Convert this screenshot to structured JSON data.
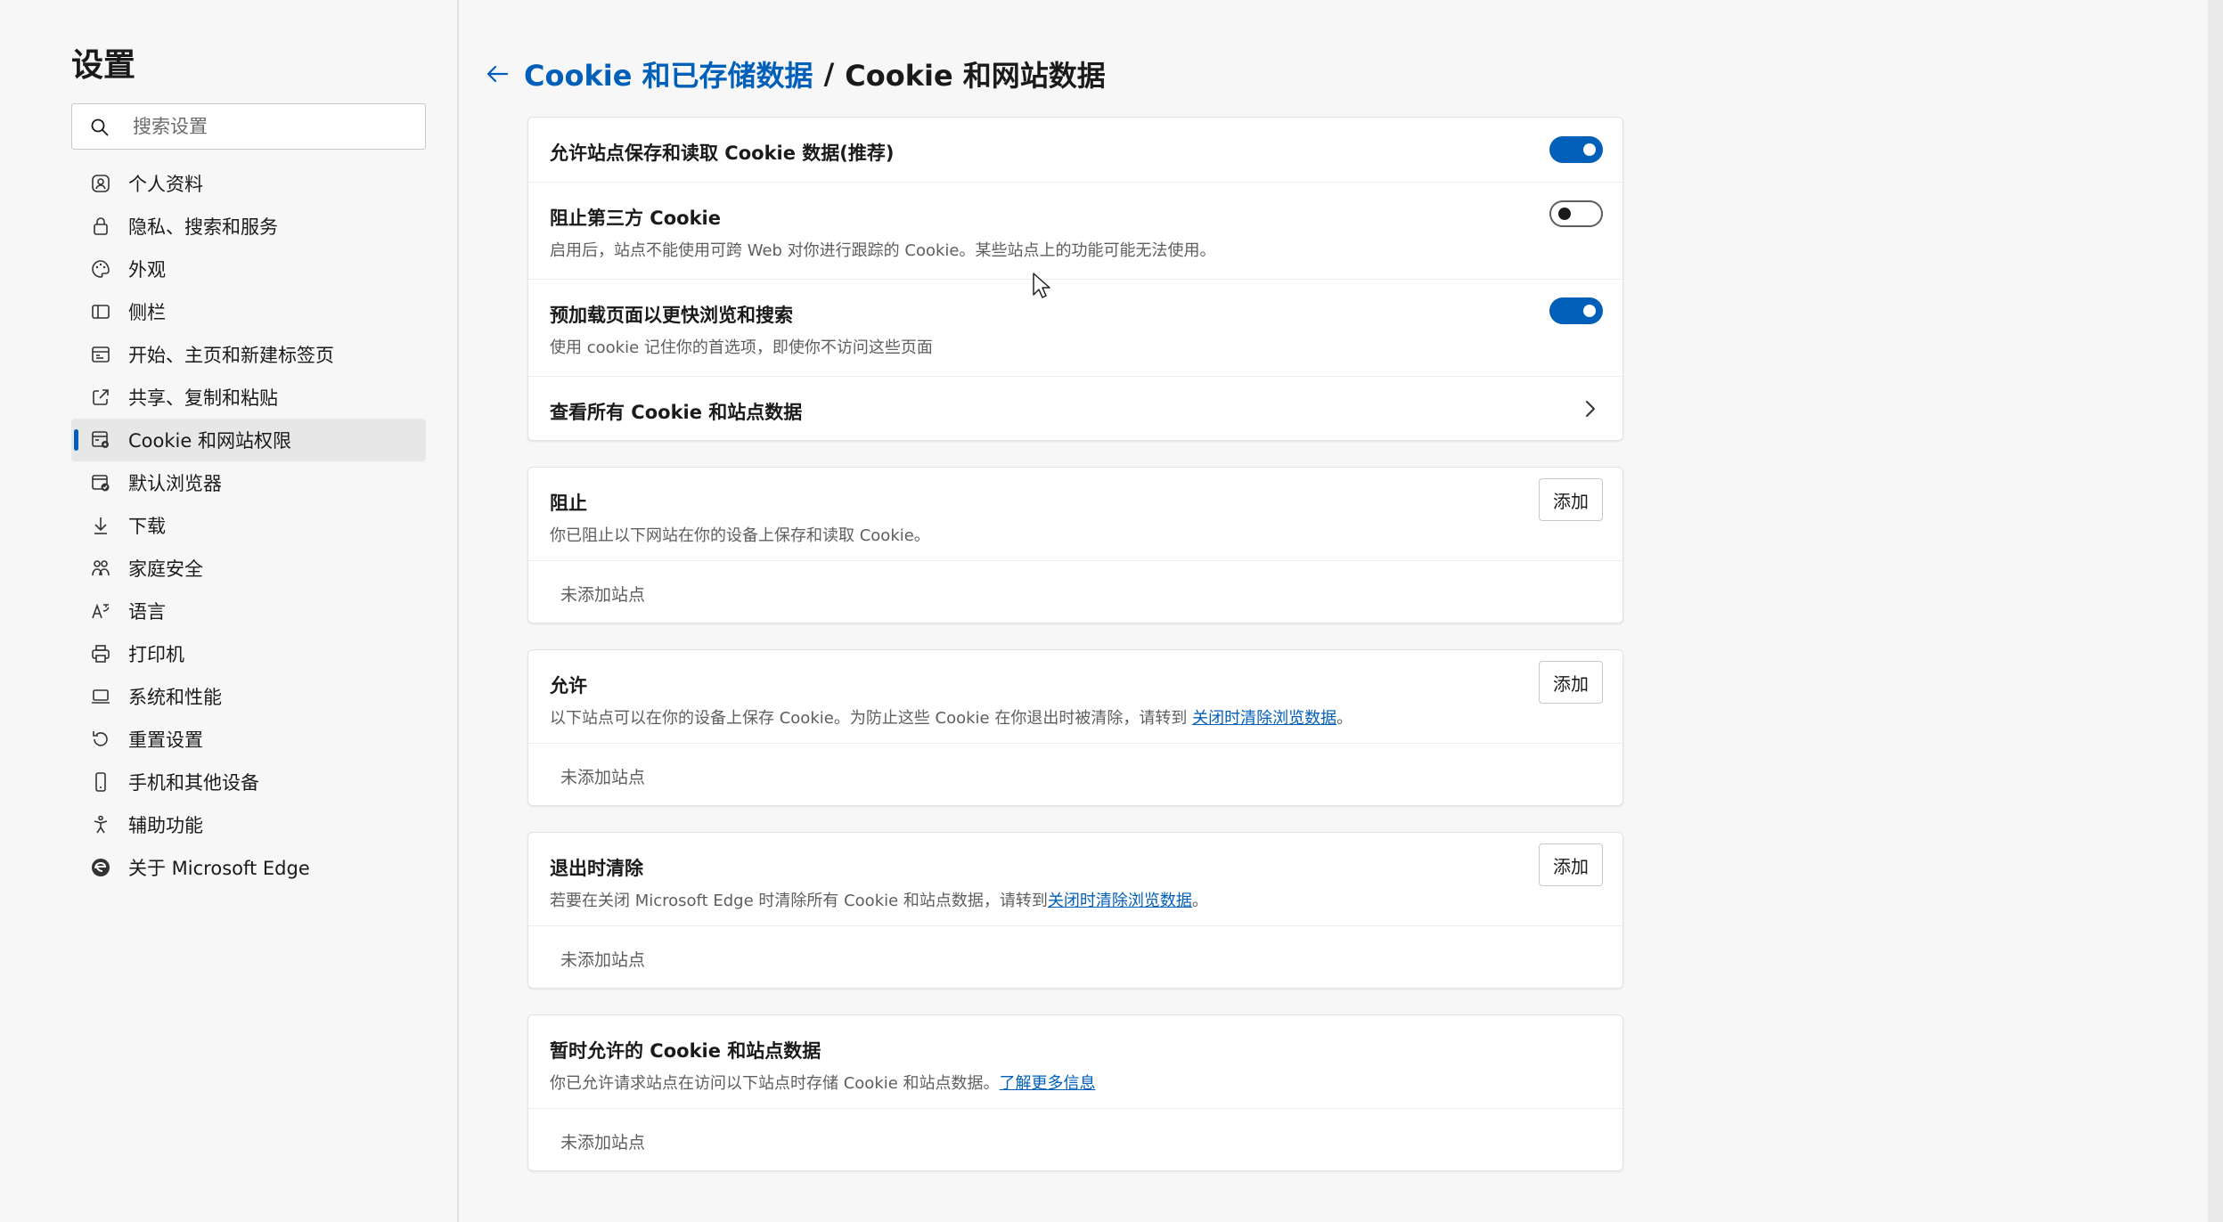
{
  "sidebar": {
    "title": "设置",
    "search": {
      "placeholder": "搜索设置",
      "value": ""
    },
    "items": [
      {
        "label": "个人资料",
        "icon": "profile-icon"
      },
      {
        "label": "隐私、搜索和服务",
        "icon": "lock-icon"
      },
      {
        "label": "外观",
        "icon": "palette-icon"
      },
      {
        "label": "侧栏",
        "icon": "sidebar-icon"
      },
      {
        "label": "开始、主页和新建标签页",
        "icon": "home-tabs-icon"
      },
      {
        "label": "共享、复制和粘贴",
        "icon": "share-icon"
      },
      {
        "label": "Cookie 和网站权限",
        "icon": "cookie-permissions-icon",
        "active": true
      },
      {
        "label": "默认浏览器",
        "icon": "default-browser-icon"
      },
      {
        "label": "下载",
        "icon": "download-icon"
      },
      {
        "label": "家庭安全",
        "icon": "family-icon"
      },
      {
        "label": "语言",
        "icon": "language-icon"
      },
      {
        "label": "打印机",
        "icon": "printer-icon"
      },
      {
        "label": "系统和性能",
        "icon": "laptop-icon"
      },
      {
        "label": "重置设置",
        "icon": "reset-icon"
      },
      {
        "label": "手机和其他设备",
        "icon": "phone-icon"
      },
      {
        "label": "辅助功能",
        "icon": "accessibility-icon"
      },
      {
        "label": "关于 Microsoft Edge",
        "icon": "edge-logo-icon"
      }
    ]
  },
  "header": {
    "parent": "Cookie 和已存储数据",
    "separator": "/",
    "current": "Cookie 和网站数据"
  },
  "cookies_card": {
    "allow": {
      "title": "允许站点保存和读取 Cookie 数据(推荐)",
      "enabled": true
    },
    "block_third_party": {
      "title": "阻止第三方 Cookie",
      "desc": "启用后，站点不能使用可跨 Web 对你进行跟踪的 Cookie。某些站点上的功能可能无法使用。",
      "enabled": false
    },
    "preload": {
      "title": "预加载页面以更快浏览和搜索",
      "desc": "使用 cookie 记住你的首选项，即使你不访问这些页面",
      "enabled": true
    },
    "view_all": {
      "title": "查看所有 Cookie 和站点数据"
    }
  },
  "block_section": {
    "title": "阻止",
    "desc": "你已阻止以下网站在你的设备上保存和读取 Cookie。",
    "add_label": "添加",
    "empty": "未添加站点"
  },
  "allow_section": {
    "title": "允许",
    "desc": "以下站点可以在你的设备上保存 Cookie。为防止这些 Cookie 在你退出时被清除，请转到 ",
    "link": "关闭时清除浏览数据",
    "desc_end": "。",
    "add_label": "添加",
    "empty": "未添加站点"
  },
  "clear_on_exit_section": {
    "title": "退出时清除",
    "desc": "若要在关闭 Microsoft Edge 时清除所有 Cookie 和站点数据，请转到",
    "link": "关闭时清除浏览数据",
    "desc_end": "。",
    "add_label": "添加",
    "empty": "未添加站点"
  },
  "temp_section": {
    "title": "暂时允许的 Cookie 和站点数据",
    "desc": "你已允许请求站点在访问以下站点时存储 Cookie 和站点数据。",
    "link": "了解更多信息",
    "empty": "未添加站点"
  },
  "colors": {
    "accent": "#005fb8",
    "background": "#f7f7f7",
    "card": "#ffffff"
  }
}
